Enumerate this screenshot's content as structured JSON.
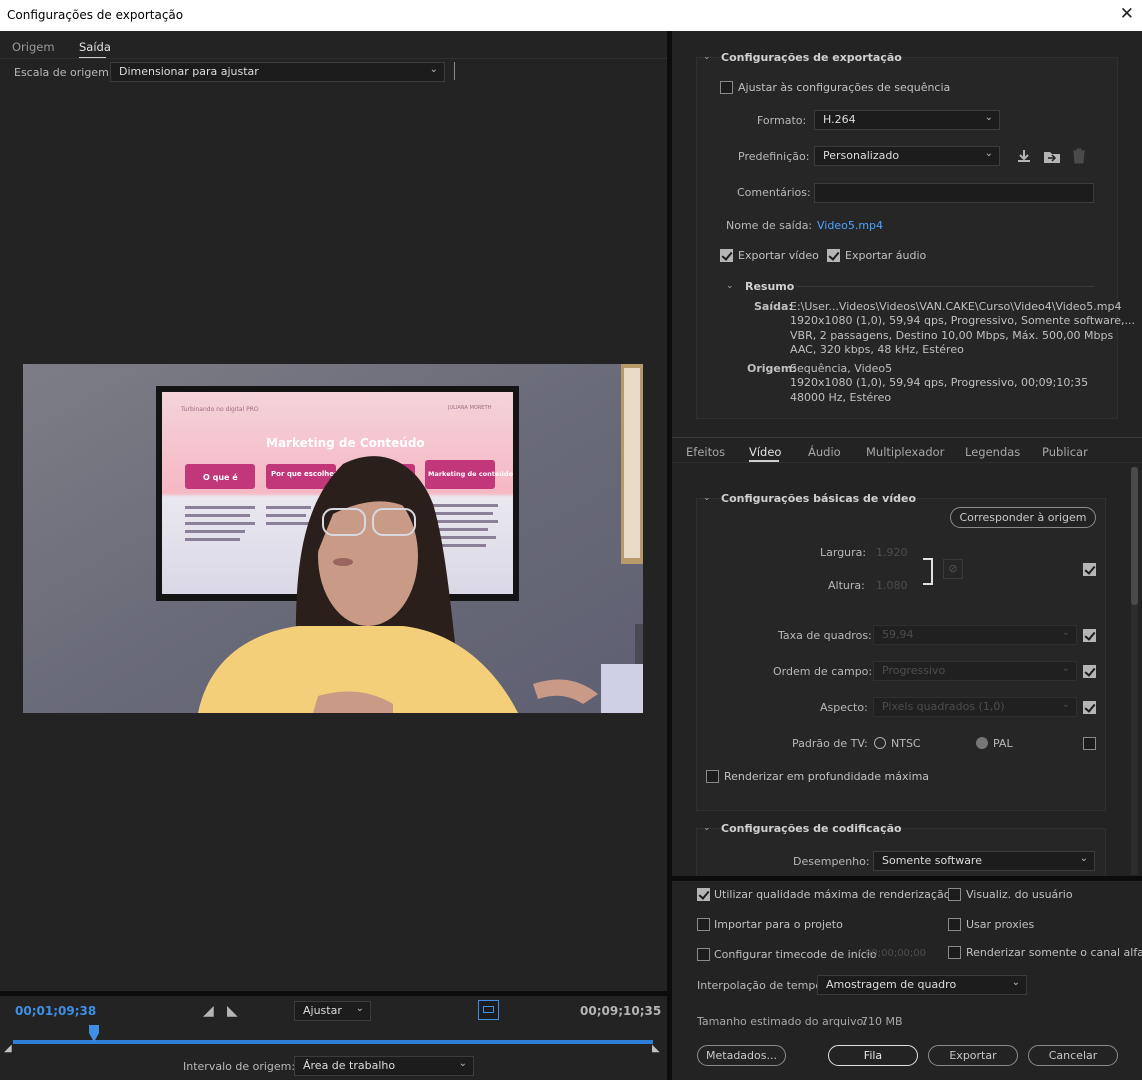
{
  "window": {
    "title": "Configurações de exportação",
    "close_glyph": "✕"
  },
  "left_tabs": [
    {
      "label": "Origem"
    },
    {
      "label": "Saída"
    }
  ],
  "source_scale": {
    "label": "Escala de origem:",
    "value": "Dimensionar para ajustar"
  },
  "preview": {
    "slide": {
      "brand": "Turbinando no digital PRO",
      "author": "JULIANA MORETH",
      "title": "Marketing de Conteúdo",
      "buttons": [
        "O que é",
        "Por que escolher ele?",
        "Marketing de conteúdo"
      ]
    }
  },
  "timeline": {
    "current_tc": "00;01;09;38",
    "total_tc": "00;09;10;35",
    "zoom_value": "Ajustar",
    "source_range_label": "Intervalo de origem:",
    "source_range_value": "Área de trabalho",
    "playhead_fraction": 0.126
  },
  "export_settings": {
    "title": "Configurações de exportação",
    "match_sequence": "Ajustar às configurações de sequência",
    "format_label": "Formato:",
    "format_value": "H.264",
    "preset_label": "Predefinição:",
    "preset_value": "Personalizado",
    "comments_label": "Comentários:",
    "output_name_label": "Nome de saída:",
    "output_name_value": "Video5.mp4",
    "export_video": "Exportar vídeo",
    "export_audio": "Exportar áudio",
    "summary_title": "Resumo",
    "summary_output_label": "Saída:",
    "summary_output_lines": [
      "E:\\User...Videos\\Videos\\VAN.CAKE\\Curso\\Video4\\Video5.mp4",
      "1920x1080 (1,0), 59,94 qps, Progressivo,  Somente software,...",
      "VBR, 2 passagens, Destino 10,00 Mbps, Máx. 500,00 Mbps",
      "AAC, 320 kbps, 48 kHz, Estéreo"
    ],
    "summary_source_label": "Origem:",
    "summary_source_lines": [
      "Sequência, Video5",
      "1920x1080 (1,0), 59,94  qps, Progressivo, 00;09;10;35",
      "48000 Hz, Estéreo"
    ]
  },
  "right_tabs": [
    {
      "label": "Efeitos"
    },
    {
      "label": "Vídeo"
    },
    {
      "label": "Áudio"
    },
    {
      "label": "Multiplexador"
    },
    {
      "label": "Legendas"
    },
    {
      "label": "Publicar"
    }
  ],
  "video_basic": {
    "title": "Configurações básicas de vídeo",
    "match_source_btn": "Corresponder à origem",
    "width_label": "Largura:",
    "width_value": "1.920",
    "height_label": "Altura:",
    "height_value": "1.080",
    "frame_rate_label": "Taxa de quadros:",
    "frame_rate_value": "59,94",
    "field_order_label": "Ordem de campo:",
    "field_order_value": "Progressivo",
    "aspect_label": "Aspecto:",
    "aspect_value": "Pixels quadrados (1,0)",
    "tv_standard_label": "Padrão de TV:",
    "ntsc": "NTSC",
    "pal": "PAL",
    "max_depth": "Renderizar em profundidade máxima"
  },
  "encoding": {
    "title": "Configurações de codificação",
    "performance_label": "Desempenho:",
    "performance_value": "Somente software"
  },
  "bottom_options": {
    "max_render_quality": "Utilizar qualidade máxima de renderização",
    "user_preview": "Visualiz. do usuário",
    "import_project": "Importar para o projeto",
    "use_proxies": "Usar proxies",
    "set_start_tc": "Configurar timecode de início",
    "start_tc_value": "00;00;00;00",
    "render_alpha": "Renderizar somente o canal alfa",
    "time_interp_label": "Interpolação de tempo:",
    "time_interp_value": "Amostragem de quadro",
    "file_size_label": "Tamanho estimado do arquivo:",
    "file_size_value": "710 MB"
  },
  "buttons": {
    "metadata": "Metadados...",
    "queue": "Fila",
    "export": "Exportar",
    "cancel": "Cancelar"
  }
}
